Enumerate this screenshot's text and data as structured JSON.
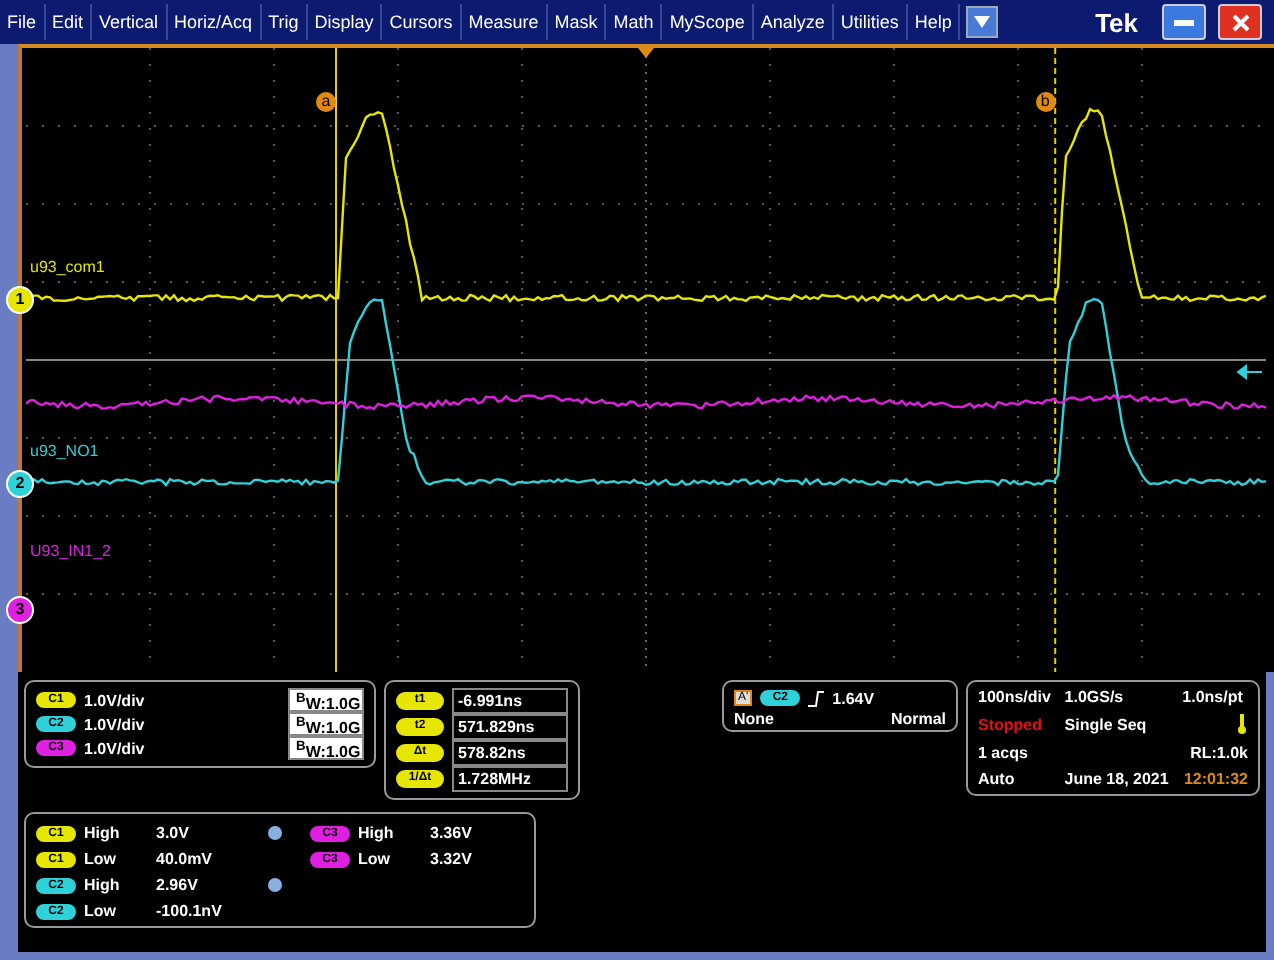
{
  "menu": {
    "items": [
      "File",
      "Edit",
      "Vertical",
      "Horiz/Acq",
      "Trig",
      "Display",
      "Cursors",
      "Measure",
      "Mask",
      "Math",
      "MyScope",
      "Analyze",
      "Utilities",
      "Help"
    ],
    "logo": "Tek"
  },
  "waveform": {
    "cursors": [
      {
        "label": "a"
      },
      {
        "label": "b"
      }
    ],
    "traces": [
      {
        "label": "u93_com1",
        "marker": "1",
        "color": "#e6e600",
        "kind": "pulse"
      },
      {
        "label": "u93_NO1",
        "marker": "2",
        "color": "#30d0d8",
        "kind": "pulse"
      },
      {
        "label": "U93_IN1_2",
        "marker": "3",
        "color": "#e020e0",
        "kind": "flat"
      }
    ]
  },
  "vertical": [
    {
      "channel": "C1",
      "color": "#e6e600",
      "scale": "1.0V/div",
      "bandwidth": "$^{B}$W:1.0G"
    },
    {
      "channel": "C2",
      "color": "#30d0d8",
      "scale": "1.0V/div",
      "bandwidth": "$^{B}$W:1.0G"
    },
    {
      "channel": "C3",
      "color": "#e020e0",
      "scale": "1.0V/div",
      "bandwidth": "$^{B}$W:1.0G"
    }
  ],
  "cursor_readouts": [
    {
      "label": "t1",
      "value": "-6.991ns"
    },
    {
      "label": "t2",
      "value": "571.829ns"
    },
    {
      "label": "Δt",
      "value": "578.82ns"
    },
    {
      "label": "1/Δt",
      "value": "1.728MHz"
    }
  ],
  "trigger": {
    "type": "A'",
    "source": "C2",
    "color": "#30d0d8",
    "level": "1.64V",
    "coupling": "None",
    "mode": "Normal"
  },
  "acquisition": {
    "timebase": "100ns/div",
    "sample_rate": "1.0GS/s",
    "resolution": "1.0ns/pt",
    "state": "Stopped",
    "sequence": "Single Seq",
    "acqs": "1 acqs",
    "record_length": "RL:1.0k",
    "mode": "Auto",
    "date": "June 18, 2021",
    "time": "12:01:32"
  },
  "measurements": [
    [
      {
        "channel": "C1",
        "color": "#e6e600",
        "name": "High",
        "value": "3.0V",
        "info": true
      },
      {
        "channel": "C1",
        "color": "#e6e600",
        "name": "Low",
        "value": "40.0mV",
        "info": false
      },
      {
        "channel": "C2",
        "color": "#30d0d8",
        "name": "High",
        "value": "2.96V",
        "info": true
      },
      {
        "channel": "C2",
        "color": "#30d0d8",
        "name": "Low",
        "value": "-100.1nV",
        "info": false
      }
    ],
    [
      {
        "channel": "C3",
        "color": "#e020e0",
        "name": "High",
        "value": "3.36V",
        "info": false
      },
      {
        "channel": "C3",
        "color": "#e020e0",
        "name": "Low",
        "value": "3.32V",
        "info": false
      }
    ]
  ]
}
